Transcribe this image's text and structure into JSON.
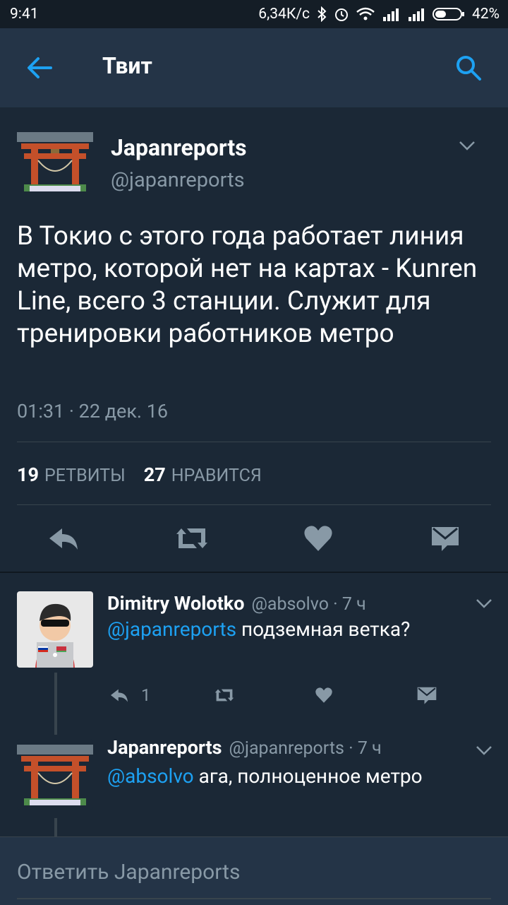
{
  "status_bar": {
    "time": "9:41",
    "speed": "6,34К/с",
    "battery": "42%",
    "icons": [
      "bluetooth-icon",
      "alarm-icon",
      "wifi-icon",
      "signal-icon",
      "signal-icon",
      "battery-icon"
    ]
  },
  "app_bar": {
    "title": "Твит",
    "back_icon": "arrow-left-icon",
    "search_icon": "search-icon"
  },
  "tweet": {
    "author_name": "Japanreports",
    "author_handle": "@japanreports",
    "text": "В Токио с этого года работает линия метро, которой нет на картах - Kunren Line, всего 3 станции. Служит для тренировки работников метро",
    "timestamp": "01:31 · 22 дек. 16",
    "retweets_count": "19",
    "retweets_label": "РЕТВИТЫ",
    "likes_count": "27",
    "likes_label": "НРАВИТСЯ",
    "actions": [
      "reply-icon",
      "retweet-icon",
      "heart-icon",
      "message-icon"
    ]
  },
  "replies": [
    {
      "name": "Dimitry Wolotko",
      "handle": "@absolvo",
      "age": "· 7 ч",
      "mention": "@japanreports",
      "text": " подземная ветка?",
      "reply_count": "1"
    },
    {
      "name": "Japanreports",
      "handle": "@japanreports",
      "age": "· 7 ч",
      "mention": "@absolvo",
      "text": " ага, полноценное метро"
    }
  ],
  "compose": {
    "placeholder": "Ответить Japanreports"
  },
  "colors": {
    "background": "#1b2836",
    "app_bar": "#243447",
    "accent": "#1da1f2",
    "secondary_text": "#8899a6",
    "icon": "#8899a6"
  }
}
